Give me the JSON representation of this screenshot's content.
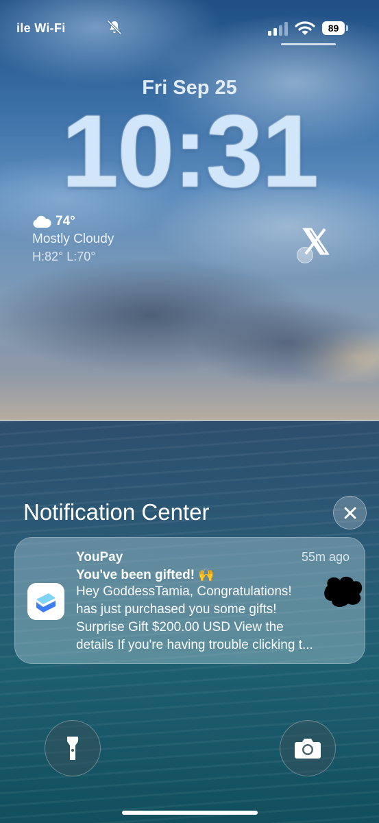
{
  "status_bar": {
    "carrier": "ile Wi-Fi",
    "battery": "89",
    "icons": [
      "bell-slash-icon",
      "signal-icon",
      "wifi-icon",
      "battery-icon"
    ]
  },
  "lock_screen": {
    "date": "Fri Sep 25",
    "time": "10:31"
  },
  "weather": {
    "icon": "cloud-icon",
    "temperature": "74°",
    "condition": "Mostly Cloudy",
    "high_low": "H:82° L:70°"
  },
  "widget": {
    "icon": "x-logo-icon"
  },
  "notification_center": {
    "title": "Notification Center",
    "close_icon": "close-icon"
  },
  "notification": {
    "app": "YouPay",
    "time_ago": "55m ago",
    "title": "You've been gifted! 🙌",
    "body_lines": [
      "Hey GoddessTamia, Congratulations!",
      "has just purchased you some gifts!",
      "Surprise Gift $200.00 USD View the",
      "details If you're having trouble clicking t..."
    ]
  },
  "quick_actions": {
    "left_icon": "flashlight-icon",
    "right_icon": "camera-icon"
  },
  "colors": {
    "time_text": "#cde4f8",
    "notification_bg": "rgba(190,215,225,0.38)",
    "app_icon_blue": "#3d7ef0"
  }
}
